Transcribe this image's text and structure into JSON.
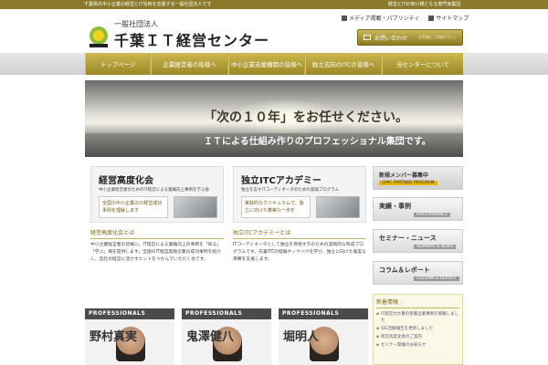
{
  "topbar": {
    "left_text": "千葉県の中小企業の経営とIT活用を支援する一般社団法人です",
    "right_text": "経営とITの架け橋となる専門家集団"
  },
  "logo": {
    "subtitle": "一般社団法人",
    "title": "千葉ＩＴ経営センター"
  },
  "header_links": {
    "media": "メディア掲載・パブリシティ",
    "sitemap": "サイトマップ"
  },
  "contact": {
    "label": "お問い合わせ",
    "note": "お気軽にご相談下さい。"
  },
  "nav": [
    {
      "label": "トップページ"
    },
    {
      "label": "企業経営者の皆様へ"
    },
    {
      "label": "中小企業支援機関の皆様へ"
    },
    {
      "label": "独立志向のITCの皆様へ"
    },
    {
      "label": "当センターについて"
    }
  ],
  "hero": {
    "headline": "「次の１０年」をお任せください。",
    "subline": "ＩＴによる仕組み作りのプロフェッショナル集団です。"
  },
  "features": [
    {
      "title": "経営高度化会",
      "subtitle": "中小企業経営者のためのIT経営による業績向上事例を学ぶ会",
      "panel": "全国の中小企業のIT経営成功事例を理解します"
    },
    {
      "title": "独立ITCアカデミー",
      "subtitle": "独立を志すITコーディネータのための実践プログラム",
      "panel": "実践的なカリキュラムで、独立に向けた着実な一歩を"
    }
  ],
  "sections": [
    {
      "heading": "経営高度化会とは",
      "body": "中小企業経営者の皆様に、IT経営による業績向上の事例を「知る」「学ぶ」場を提供します。全国のIT経営実践企業の成功事例を紹介し、自社の経営に活かすヒントをつかんでいただく会です。"
    },
    {
      "heading": "独立ITCアカデミーとは",
      "body": "ITコーディネータとして独立を目指す方のための実践的な育成プログラムです。先輩ITCの経験やノウハウを学び、独立に向けた着実な準備を支援します。"
    }
  ],
  "professionals": [
    {
      "label": "PROFESSIONALS",
      "name": "野村真実"
    },
    {
      "label": "PROFESSIONALS",
      "name": "鬼澤健八"
    },
    {
      "label": "PROFESSIONALS",
      "name": "堀明人"
    }
  ],
  "sidebar": {
    "recruit": {
      "title": "新規メンバー募集中",
      "sub": "CIMC PARTNER PROGRAM"
    },
    "buttons": [
      {
        "title": "実績・事例",
        "sub": "PERFORMANCE"
      },
      {
        "title": "セミナー・ニュース",
        "sub": "SEMINAR & NEWS"
      },
      {
        "title": "コラム＆レポート",
        "sub": "COLUMN & REPORT"
      }
    ],
    "news": {
      "heading": "新着情報",
      "items": [
        "IT経営力大賞の受賞企業事例を掲載しました",
        "SIG活動報告を更新しました",
        "経営高度化会のご案内",
        "セミナー開催のお知らせ"
      ]
    }
  }
}
